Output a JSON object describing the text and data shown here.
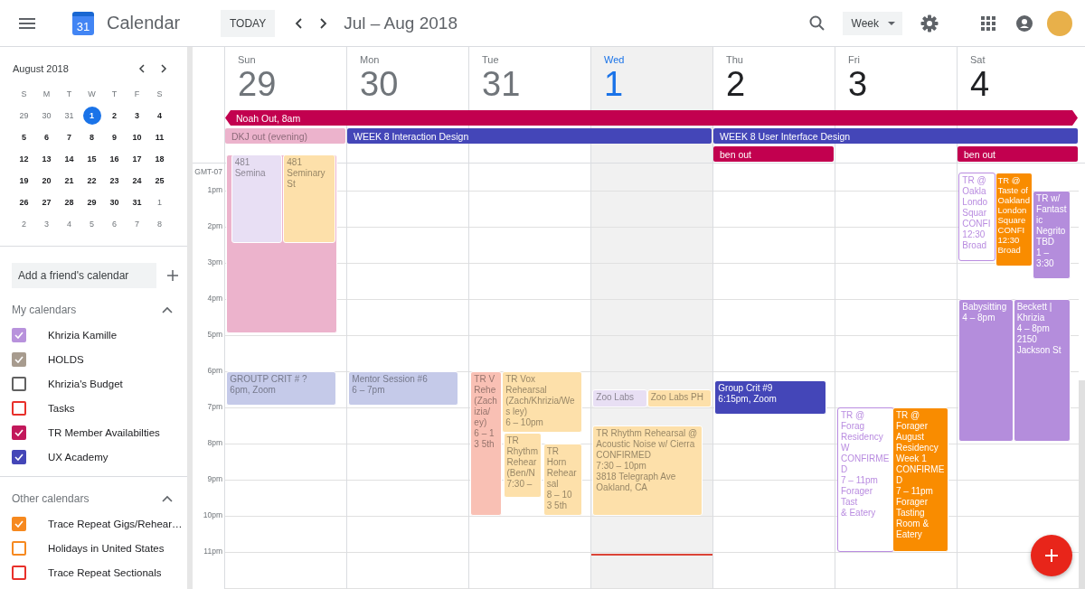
{
  "header": {
    "logo_text": "31",
    "app_title": "Calendar",
    "today_button": "TODAY",
    "date_range": "Jul – Aug 2018",
    "view_select": "Week"
  },
  "mini_calendar": {
    "title": "August 2018",
    "weekdays": [
      "S",
      "M",
      "T",
      "W",
      "T",
      "F",
      "S"
    ],
    "weeks": [
      [
        {
          "day": "29",
          "other_month": true,
          "today": false
        },
        {
          "day": "30",
          "other_month": true,
          "today": false
        },
        {
          "day": "31",
          "other_month": true,
          "today": false
        },
        {
          "day": "1",
          "other_month": false,
          "today": true
        },
        {
          "day": "2",
          "other_month": false,
          "today": false
        },
        {
          "day": "3",
          "other_month": false,
          "today": false
        },
        {
          "day": "4",
          "other_month": false,
          "today": false
        }
      ],
      [
        {
          "day": "5",
          "other_month": false,
          "today": false
        },
        {
          "day": "6",
          "other_month": false,
          "today": false
        },
        {
          "day": "7",
          "other_month": false,
          "today": false
        },
        {
          "day": "8",
          "other_month": false,
          "today": false
        },
        {
          "day": "9",
          "other_month": false,
          "today": false
        },
        {
          "day": "10",
          "other_month": false,
          "today": false
        },
        {
          "day": "11",
          "other_month": false,
          "today": false
        }
      ],
      [
        {
          "day": "12",
          "other_month": false,
          "today": false
        },
        {
          "day": "13",
          "other_month": false,
          "today": false
        },
        {
          "day": "14",
          "other_month": false,
          "today": false
        },
        {
          "day": "15",
          "other_month": false,
          "today": false
        },
        {
          "day": "16",
          "other_month": false,
          "today": false
        },
        {
          "day": "17",
          "other_month": false,
          "today": false
        },
        {
          "day": "18",
          "other_month": false,
          "today": false
        }
      ],
      [
        {
          "day": "19",
          "other_month": false,
          "today": false
        },
        {
          "day": "20",
          "other_month": false,
          "today": false
        },
        {
          "day": "21",
          "other_month": false,
          "today": false
        },
        {
          "day": "22",
          "other_month": false,
          "today": false
        },
        {
          "day": "23",
          "other_month": false,
          "today": false
        },
        {
          "day": "24",
          "other_month": false,
          "today": false
        },
        {
          "day": "25",
          "other_month": false,
          "today": false
        }
      ],
      [
        {
          "day": "26",
          "other_month": false,
          "today": false
        },
        {
          "day": "27",
          "other_month": false,
          "today": false
        },
        {
          "day": "28",
          "other_month": false,
          "today": false
        },
        {
          "day": "29",
          "other_month": false,
          "today": false
        },
        {
          "day": "30",
          "other_month": false,
          "today": false
        },
        {
          "day": "31",
          "other_month": false,
          "today": false
        },
        {
          "day": "1",
          "other_month": true,
          "today": false
        }
      ],
      [
        {
          "day": "2",
          "other_month": true,
          "today": false
        },
        {
          "day": "3",
          "other_month": true,
          "today": false
        },
        {
          "day": "4",
          "other_month": true,
          "today": false
        },
        {
          "day": "5",
          "other_month": true,
          "today": false
        },
        {
          "day": "6",
          "other_month": true,
          "today": false
        },
        {
          "day": "7",
          "other_month": true,
          "today": false
        },
        {
          "day": "8",
          "other_month": true,
          "today": false
        }
      ]
    ]
  },
  "friend_field": {
    "placeholder": "Add a friend's calendar"
  },
  "calendar_groups": [
    {
      "title": "My calendars",
      "expanded": true,
      "items": [
        {
          "name": "Khrizia Kamille",
          "checked": true,
          "color": "#b892dc"
        },
        {
          "name": "HOLDS",
          "checked": true,
          "color": "#a79b8e"
        },
        {
          "name": "Khrizia's Budget",
          "checked": false,
          "color": "#616161"
        },
        {
          "name": "Tasks",
          "checked": false,
          "color": "#e8302a"
        },
        {
          "name": "TR Member Availabilties",
          "checked": true,
          "color": "#c2185b"
        },
        {
          "name": "UX Academy",
          "checked": true,
          "color": "#4446b8"
        }
      ]
    },
    {
      "title": "Other calendars",
      "expanded": true,
      "items": [
        {
          "name": "Trace Repeat Gigs/Rehear…",
          "checked": true,
          "color": "#f6891f"
        },
        {
          "name": "Holidays in United States",
          "checked": false,
          "color": "#f6891f"
        },
        {
          "name": "Trace Repeat Sectionals",
          "checked": false,
          "color": "#e8302a"
        }
      ]
    }
  ],
  "week": {
    "timezone": "GMT-07",
    "hours": [
      "1pm",
      "2pm",
      "3pm",
      "4pm",
      "5pm",
      "6pm",
      "7pm",
      "8pm",
      "9pm",
      "10pm",
      "11pm"
    ],
    "all_day": [
      {
        "title": "Noah Out, 8am",
        "kind": "solid",
        "color": "#c2004f"
      },
      {
        "title": "DKJ out (evening)",
        "kind": "faded",
        "color": "#ecb3cc"
      },
      {
        "title": "WEEK 8 Interaction Design",
        "kind": "solid",
        "color": "#4446b8"
      },
      {
        "title": "WEEK 8 User Interface Design",
        "kind": "solid",
        "color": "#4446b8"
      },
      {
        "title": "ben out",
        "kind": "solid",
        "color": "#c2004f"
      },
      {
        "title": "ben out",
        "kind": "solid",
        "color": "#c2004f"
      }
    ],
    "days": [
      {
        "name": "Sun",
        "date": "29",
        "past": true,
        "today": false,
        "events": [
          {
            "kind": "faded",
            "color": "#ecb3cc"
          },
          {
            "kind": "faded",
            "color": "#e8dff4",
            "lines": [
              "481 Semina"
            ]
          },
          {
            "kind": "faded",
            "color": "#fde0aa",
            "lines": [
              "481 Seminary St"
            ]
          },
          {
            "kind": "faded",
            "color": "#c5cae9",
            "lines": [
              "GROUTP CRIT # ?",
              "6pm, Zoom"
            ]
          }
        ]
      },
      {
        "name": "Mon",
        "date": "30",
        "past": true,
        "today": false,
        "events": [
          {
            "kind": "faded",
            "color": "#c5cae9",
            "lines": [
              "Mentor Session #6",
              "6 – 7pm"
            ]
          }
        ]
      },
      {
        "name": "Tue",
        "date": "31",
        "past": true,
        "today": false,
        "events": [
          {
            "kind": "faded",
            "color": "#f9c0b4",
            "lines": [
              "TR V",
              "Rehe",
              "(Zach",
              "izia/",
              "ey)",
              "6 – 1",
              "3 5th"
            ]
          },
          {
            "kind": "faded",
            "color": "#fde0aa",
            "lines": [
              "TR Vox Rehearsal",
              "(Zach/Khrizia/Wes ley)",
              "6 – 10pm"
            ]
          },
          {
            "kind": "faded",
            "color": "#fde0aa",
            "lines": [
              "TR Rhythm",
              "Rehear",
              "(Ben/N",
              "7:30 –"
            ]
          },
          {
            "kind": "faded",
            "color": "#fde0aa",
            "lines": [
              "TR",
              "Horn",
              "Rehear",
              "sal",
              "8 – 10",
              "3 5th"
            ]
          }
        ]
      },
      {
        "name": "Wed",
        "date": "1",
        "past": false,
        "today": true,
        "events": [
          {
            "kind": "faded",
            "color": "#e8dff4",
            "lines": [
              "Zoo Labs"
            ]
          },
          {
            "kind": "faded",
            "color": "#fde0aa",
            "lines": [
              "Zoo Labs PH"
            ]
          },
          {
            "kind": "faded",
            "color": "#fde0aa",
            "lines": [
              "TR Rhythm Rehearsal @ Acoustic Noise w/ Cierra CONFIRMED",
              "7:30 – 10pm",
              "3818 Telegraph Ave Oakland, CA"
            ]
          }
        ]
      },
      {
        "name": "Thu",
        "date": "2",
        "past": false,
        "today": false,
        "events": [
          {
            "kind": "solid",
            "color": "#4446b8",
            "lines": [
              "Group Crit #9",
              "6:15pm, Zoom"
            ]
          }
        ]
      },
      {
        "name": "Fri",
        "date": "3",
        "past": false,
        "today": false,
        "events": [
          {
            "kind": "outline",
            "color": "#b98ce0",
            "lines": [
              "TR @ Forag",
              "Residency W",
              "CONFIRMED",
              "7 – 11pm",
              "Forager Tast",
              "& Eatery"
            ]
          },
          {
            "kind": "solid",
            "color": "#f98c00",
            "lines": [
              "TR @ Forager August Residency Week 1 CONFIRMED",
              "7 – 11pm",
              "Forager Tasting Room & Eatery"
            ]
          }
        ]
      },
      {
        "name": "Sat",
        "date": "4",
        "past": false,
        "today": false,
        "events": [
          {
            "kind": "outline",
            "color": "#b98ce0",
            "lines": [
              "TR @",
              "Oakla",
              "Londo",
              "Squar",
              "CONFI",
              "12:30",
              "Broad"
            ]
          },
          {
            "kind": "solid",
            "color": "#f98c00",
            "lines": [
              "TR @ Taste of",
              "Oakland",
              "London",
              "Square",
              "CONFI",
              "12:30",
              "Broad"
            ]
          },
          {
            "kind": "solid",
            "color": "#b48ddc",
            "lines": [
              "TR w/ Fantastic Negrito TBD",
              "1 – 3:30"
            ]
          },
          {
            "kind": "solid",
            "color": "#b48ddc",
            "lines": [
              "Babysitting",
              "4 – 8pm"
            ]
          },
          {
            "kind": "solid",
            "color": "#b48ddc",
            "lines": [
              "Beckett | Khrizia",
              "4 – 8pm",
              "2150 Jackson St"
            ]
          }
        ]
      }
    ]
  }
}
